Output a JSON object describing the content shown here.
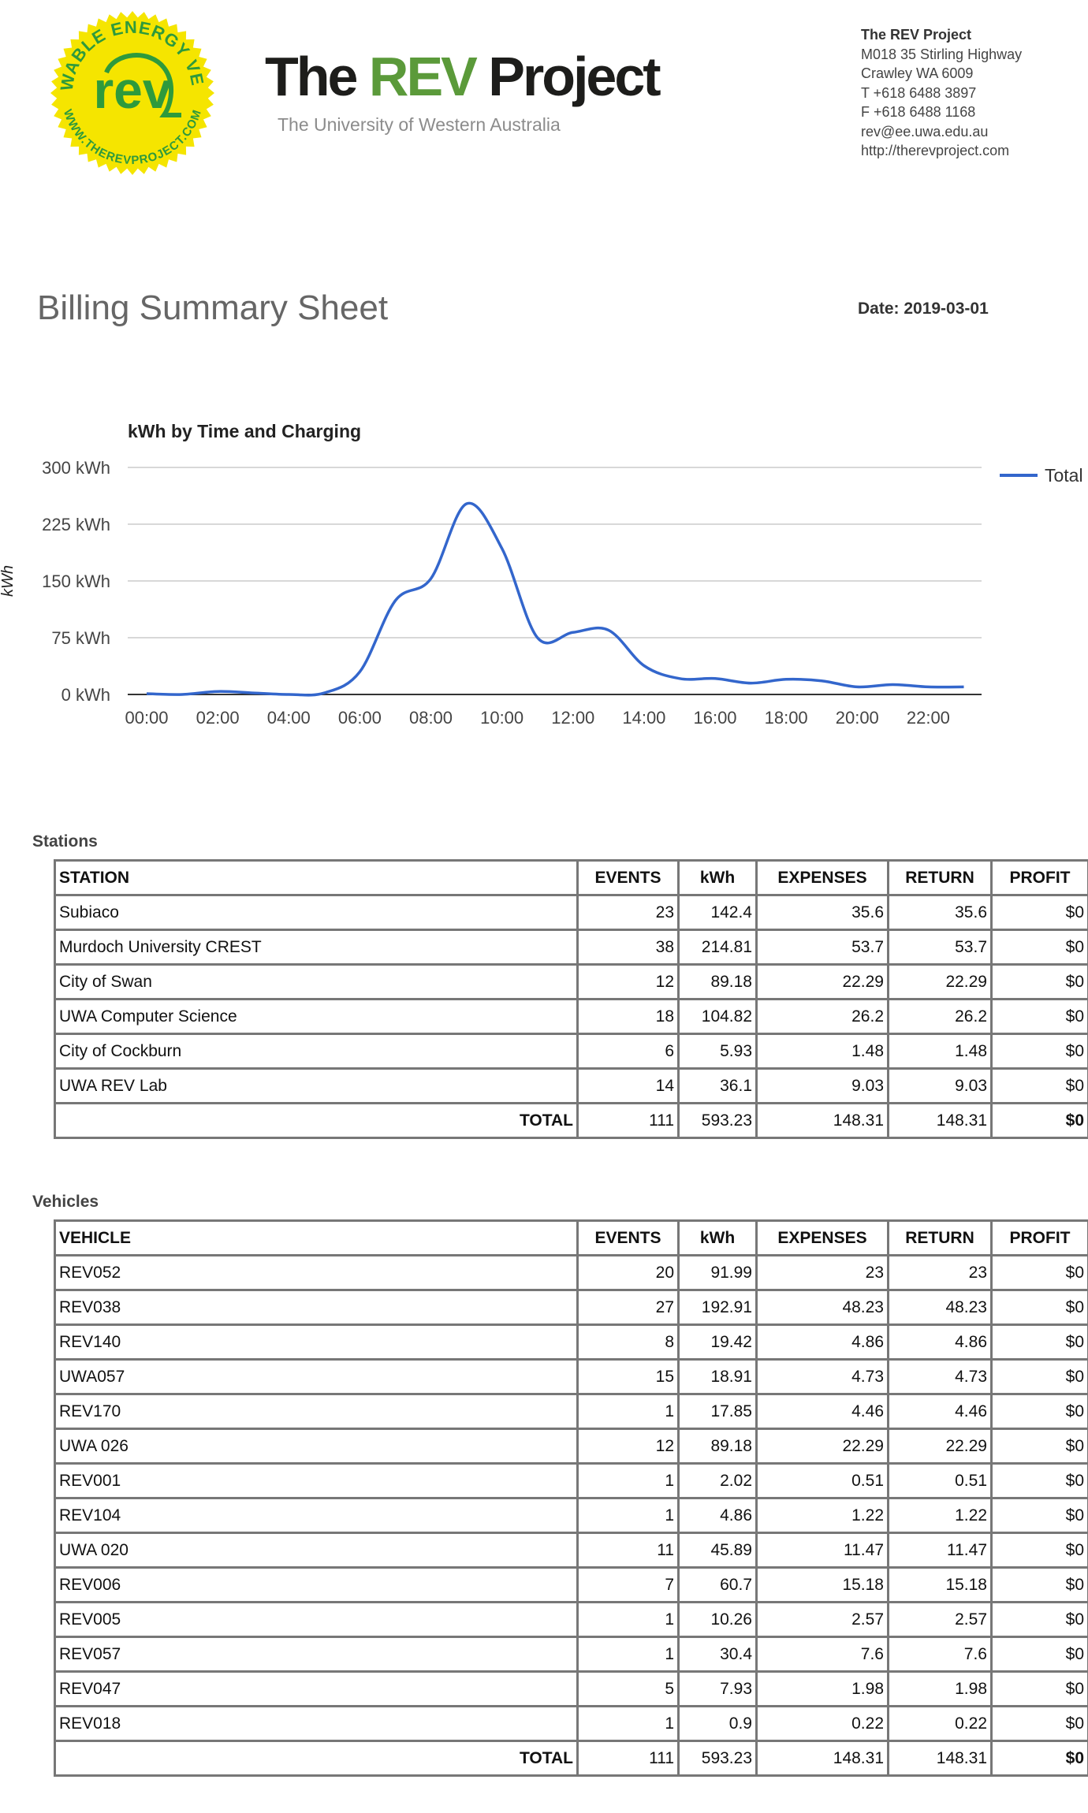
{
  "header": {
    "logo": {
      "ring_text_top": "RENEWABLE ENERGY VEHICLE",
      "ring_text_bottom": "WWW.THEREVPROJECT.COM",
      "center_text": "rev",
      "colors": {
        "yellow": "#f5e500",
        "green": "#2e9a3c"
      }
    },
    "title_part1": "The ",
    "title_part2": "REV",
    "title_part3": " Project",
    "subtitle": "The University of Western Australia"
  },
  "contact": {
    "org": "The REV Project",
    "address1": "M018 35 Stirling Highway",
    "address2": "Crawley WA 6009",
    "phone": "T +618 6488 3897",
    "fax": "F +618 6488 1168",
    "email": "rev@ee.uwa.edu.au",
    "web": "http://therevproject.com"
  },
  "page": {
    "title": "Billing Summary Sheet",
    "date_line": "Date: 2019-03-01"
  },
  "chart_data": {
    "type": "line",
    "title": "kWh by Time and Charging",
    "ylabel": "kWh",
    "xlabel": "",
    "ylim": [
      0,
      300
    ],
    "yticks": [
      0,
      75,
      150,
      225,
      300
    ],
    "ytick_labels": [
      "0 kWh",
      "75 kWh",
      "150 kWh",
      "225 kWh",
      "300 kWh"
    ],
    "xticks": [
      0,
      2,
      4,
      6,
      8,
      10,
      12,
      14,
      16,
      18,
      20,
      22
    ],
    "xtick_labels": [
      "00:00",
      "02:00",
      "04:00",
      "06:00",
      "08:00",
      "10:00",
      "12:00",
      "14:00",
      "16:00",
      "18:00",
      "20:00",
      "22:00"
    ],
    "grid": true,
    "legend": "right",
    "series": [
      {
        "name": "Total",
        "color": "#3366cc",
        "x": [
          0,
          1,
          2,
          3,
          4,
          5,
          6,
          7,
          8,
          9,
          10,
          11,
          12,
          13,
          14,
          15,
          16,
          17,
          18,
          19,
          20,
          21,
          22,
          23
        ],
        "y": [
          1,
          0,
          4,
          2,
          0,
          2,
          30,
          124,
          153,
          252,
          193,
          75,
          82,
          85,
          38,
          21,
          21,
          15,
          20,
          18,
          10,
          13,
          10,
          10
        ]
      }
    ]
  },
  "stations": {
    "label": "Stations",
    "headers": [
      "STATION",
      "EVENTS",
      "kWh",
      "EXPENSES",
      "RETURN",
      "PROFIT"
    ],
    "rows": [
      [
        "Subiaco",
        "23",
        "142.4",
        "35.6",
        "35.6",
        "$0"
      ],
      [
        "Murdoch University CREST",
        "38",
        "214.81",
        "53.7",
        "53.7",
        "$0"
      ],
      [
        "City of Swan",
        "12",
        "89.18",
        "22.29",
        "22.29",
        "$0"
      ],
      [
        "UWA Computer Science",
        "18",
        "104.82",
        "26.2",
        "26.2",
        "$0"
      ],
      [
        "City of Cockburn",
        "6",
        "5.93",
        "1.48",
        "1.48",
        "$0"
      ],
      [
        "UWA REV Lab",
        "14",
        "36.1",
        "9.03",
        "9.03",
        "$0"
      ]
    ],
    "total": [
      "TOTAL",
      "111",
      "593.23",
      "148.31",
      "148.31",
      "$0"
    ]
  },
  "vehicles": {
    "label": "Vehicles",
    "headers": [
      "VEHICLE",
      "EVENTS",
      "kWh",
      "EXPENSES",
      "RETURN",
      "PROFIT"
    ],
    "rows": [
      [
        "REV052",
        "20",
        "91.99",
        "23",
        "23",
        "$0"
      ],
      [
        "REV038",
        "27",
        "192.91",
        "48.23",
        "48.23",
        "$0"
      ],
      [
        "REV140",
        "8",
        "19.42",
        "4.86",
        "4.86",
        "$0"
      ],
      [
        "UWA057",
        "15",
        "18.91",
        "4.73",
        "4.73",
        "$0"
      ],
      [
        "REV170",
        "1",
        "17.85",
        "4.46",
        "4.46",
        "$0"
      ],
      [
        "UWA 026",
        "12",
        "89.18",
        "22.29",
        "22.29",
        "$0"
      ],
      [
        "REV001",
        "1",
        "2.02",
        "0.51",
        "0.51",
        "$0"
      ],
      [
        "REV104",
        "1",
        "4.86",
        "1.22",
        "1.22",
        "$0"
      ],
      [
        "UWA 020",
        "11",
        "45.89",
        "11.47",
        "11.47",
        "$0"
      ],
      [
        "REV006",
        "7",
        "60.7",
        "15.18",
        "15.18",
        "$0"
      ],
      [
        "REV005",
        "1",
        "10.26",
        "2.57",
        "2.57",
        "$0"
      ],
      [
        "REV057",
        "1",
        "30.4",
        "7.6",
        "7.6",
        "$0"
      ],
      [
        "REV047",
        "5",
        "7.93",
        "1.98",
        "1.98",
        "$0"
      ],
      [
        "REV018",
        "1",
        "0.9",
        "0.22",
        "0.22",
        "$0"
      ]
    ],
    "total": [
      "TOTAL",
      "111",
      "593.23",
      "148.31",
      "148.31",
      "$0"
    ]
  }
}
